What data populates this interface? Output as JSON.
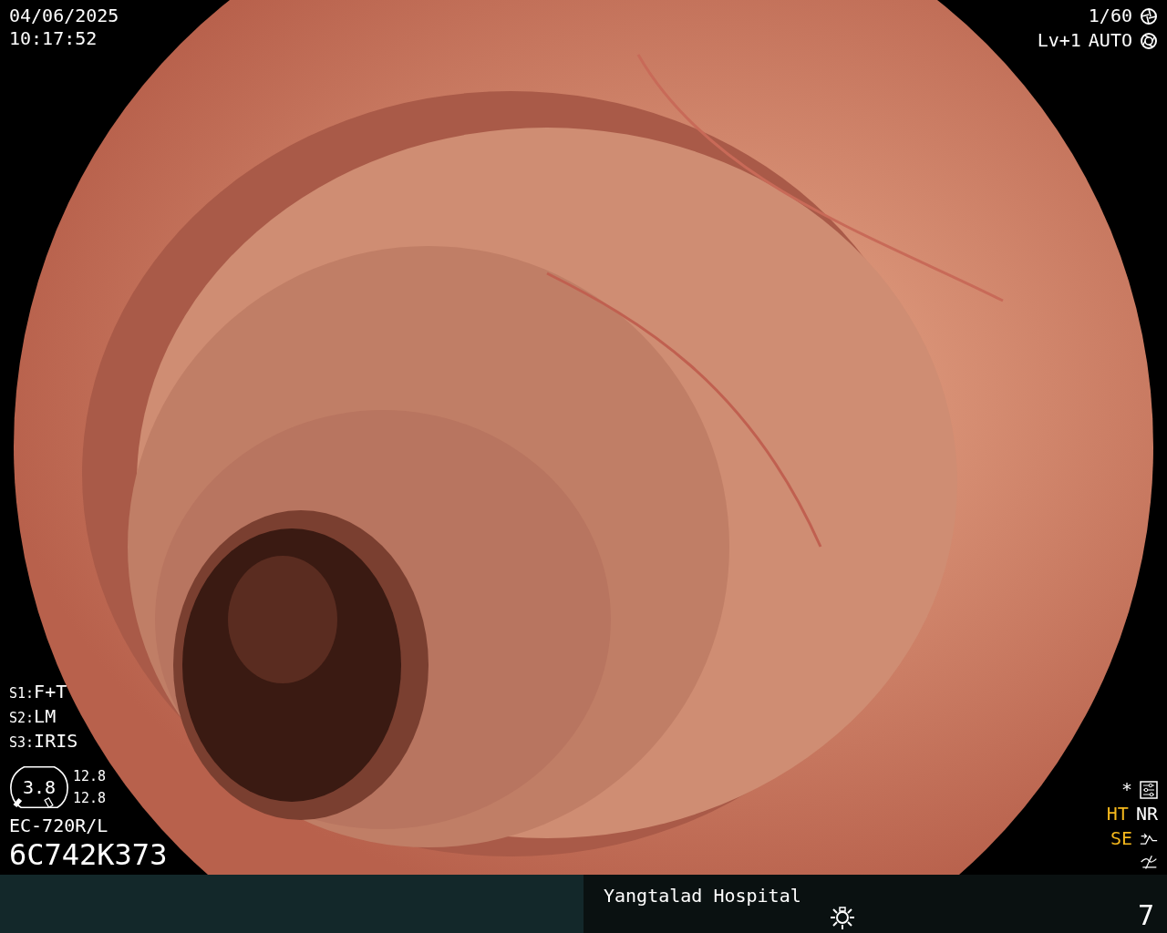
{
  "header": {
    "date": "04/06/2025",
    "time": "10:17:52"
  },
  "exposure": {
    "shutter": "1/60",
    "level": "Lv+1",
    "mode": "AUTO"
  },
  "switches": [
    {
      "key": "S1:",
      "value": "F+T"
    },
    {
      "key": "S2:",
      "value": "LM"
    },
    {
      "key": "S3:",
      "value": "IRIS"
    }
  ],
  "scope": {
    "zoom": "3.8",
    "readings": [
      "12.8",
      "12.8"
    ],
    "model": "EC-720R/L",
    "serial": "6C742K373"
  },
  "image_settings": {
    "marker": "*",
    "modes": [
      {
        "label": "HT",
        "on": true
      },
      {
        "label": "NR",
        "on": false
      }
    ],
    "enhance": {
      "label": "SE",
      "on": true
    }
  },
  "footer": {
    "hospital": "Yangtalad Hospital",
    "count": "7"
  }
}
